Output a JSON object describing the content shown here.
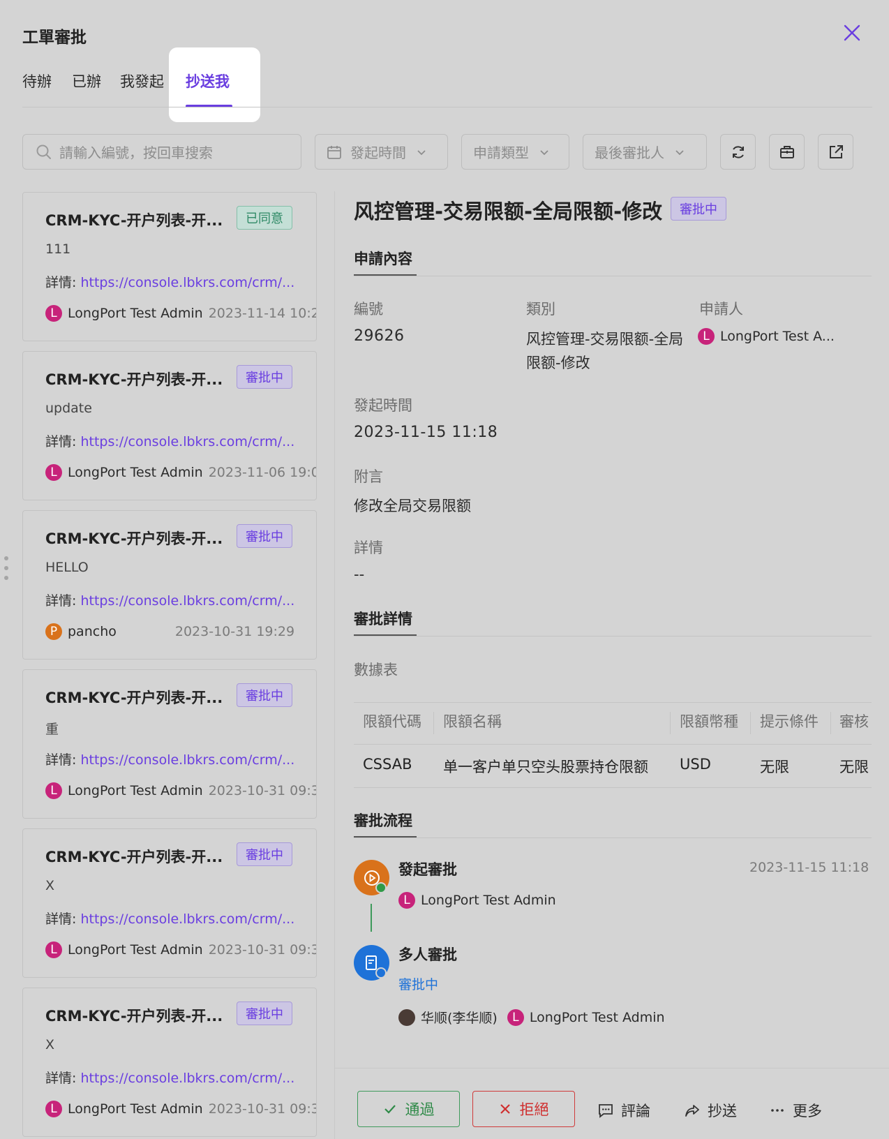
{
  "header": {
    "title": "工單審批",
    "tabs": [
      "待辦",
      "已辦",
      "我發起",
      "抄送我"
    ],
    "active_tab": "抄送我"
  },
  "filters": {
    "search_placeholder": "請輸入編號，按回車搜索",
    "date_label": "發起時間",
    "type_label": "申請類型",
    "approver_label": "最後審批人"
  },
  "list": [
    {
      "title": "CRM-KYC-开户列表-开...",
      "status": "已同意",
      "desc": "111",
      "detail_label": "詳情:",
      "detail_link": "https://console.lbkrs.com/crm/...",
      "avatar": "L",
      "user": "LongPort Test Admin",
      "time": "2023-11-14 10:2"
    },
    {
      "title": "CRM-KYC-开户列表-开...",
      "status": "審批中",
      "desc": "update",
      "detail_label": "詳情:",
      "detail_link": "https://console.lbkrs.com/crm/...",
      "avatar": "L",
      "user": "LongPort Test Admin",
      "time": "2023-11-06 19:0"
    },
    {
      "title": "CRM-KYC-开户列表-开...",
      "status": "審批中",
      "desc": "HELLO",
      "detail_label": "詳情:",
      "detail_link": "https://console.lbkrs.com/crm/...",
      "avatar": "P",
      "user": "pancho",
      "time": "2023-10-31 19:29"
    },
    {
      "title": "CRM-KYC-开户列表-开...",
      "status": "審批中",
      "desc": "重",
      "detail_label": "詳情:",
      "detail_link": "https://console.lbkrs.com/crm/...",
      "avatar": "L",
      "user": "LongPort Test Admin",
      "time": "2023-10-31 09:3"
    },
    {
      "title": "CRM-KYC-开户列表-开...",
      "status": "審批中",
      "desc": "X",
      "detail_label": "詳情:",
      "detail_link": "https://console.lbkrs.com/crm/...",
      "avatar": "L",
      "user": "LongPort Test Admin",
      "time": "2023-10-31 09:3"
    },
    {
      "title": "CRM-KYC-开户列表-开...",
      "status": "審批中",
      "desc": "X",
      "detail_label": "詳情:",
      "detail_link": "https://console.lbkrs.com/crm/...",
      "avatar": "L",
      "user": "LongPort Test Admin",
      "time": "2023-10-31 09:3"
    }
  ],
  "detail": {
    "title": "风控管理-交易限额-全局限额-修改",
    "status": "審批中",
    "section_content": "申請內容",
    "number_label": "編號",
    "number": "29626",
    "category_label": "類別",
    "category_line1": "风控管理-交易限额-全局",
    "category_line2": "限额-修改",
    "applicant_label": "申請人",
    "applicant_avatar": "L",
    "applicant": "LongPort Test A...",
    "time_label": "發起時間",
    "time": "2023-11-15 11:18",
    "note_label": "附言",
    "note": "修改全局交易限额",
    "detail_label": "詳情",
    "detail_value": "--",
    "section_approval_detail": "審批詳情",
    "table_label": "數據表",
    "table": {
      "headers": [
        "限額代碼",
        "限額名稱",
        "限額幣種",
        "提示條件",
        "審核"
      ],
      "row": [
        "CSSAB",
        "单一客户单只空头股票持仓限额",
        "USD",
        "无限",
        "无限"
      ]
    },
    "section_flow": "審批流程",
    "flow": {
      "step1_title": "發起審批",
      "step1_time": "2023-11-15 11:18",
      "step1_avatar": "L",
      "step1_user": "LongPort Test Admin",
      "step2_title": "多人審批",
      "step2_status": "審批中",
      "step2_user1": "华顺(李华顺)",
      "step2_avatar2": "L",
      "step2_user2": "LongPort Test Admin"
    }
  },
  "footer": {
    "approve": "通過",
    "reject": "拒絕",
    "comment": "評論",
    "cc": "抄送",
    "more": "更多"
  }
}
